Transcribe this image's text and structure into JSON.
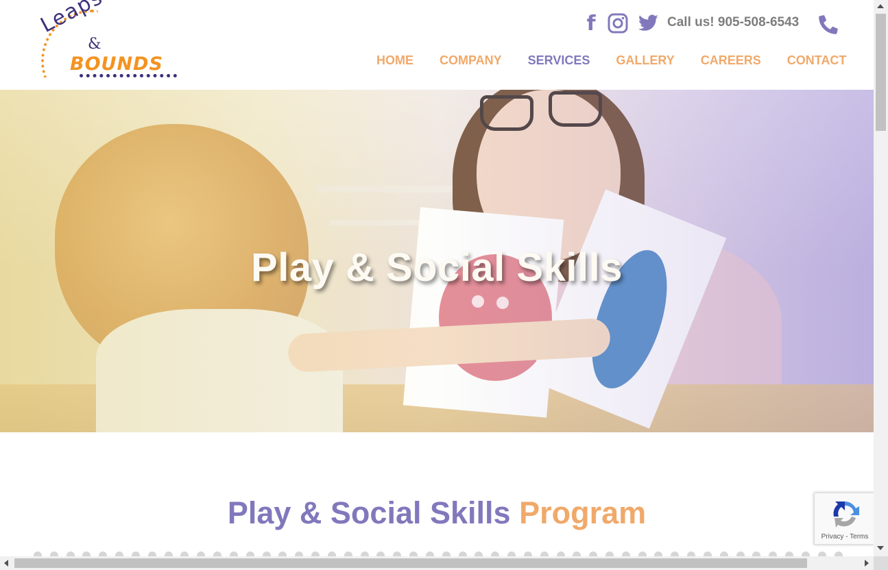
{
  "logo": {
    "word_top": "Leaps",
    "amp": "&",
    "word_bottom": "BOUNDS"
  },
  "header": {
    "social": {
      "facebook_icon": "facebook-icon",
      "instagram_icon": "instagram-icon",
      "twitter_icon": "twitter-icon"
    },
    "call_text": "Call us! 905-508-6543",
    "phone_icon": "phone-icon"
  },
  "nav": {
    "items": [
      {
        "label": "HOME"
      },
      {
        "label": "COMPANY"
      },
      {
        "label": "SERVICES"
      },
      {
        "label": "GALLERY"
      },
      {
        "label": "CAREERS"
      },
      {
        "label": "CONTACT"
      }
    ],
    "active": "SERVICES"
  },
  "hero": {
    "title": "Play & Social Skills"
  },
  "section": {
    "title_part1": "Play & Social Skills",
    "title_part2": "Program"
  },
  "recaptcha": {
    "footer": "Privacy - Terms"
  },
  "colors": {
    "brand_purple": "#8178bc",
    "brand_orange": "#f0a96a",
    "logo_navy": "#3d2f7a",
    "logo_orange": "#f39321"
  }
}
